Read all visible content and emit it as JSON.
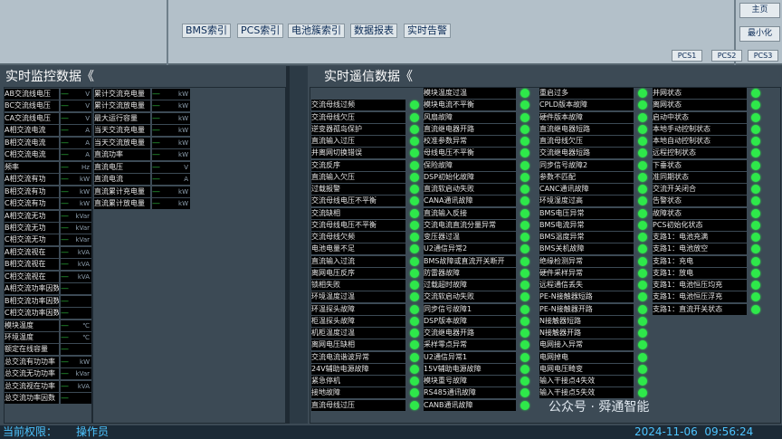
{
  "nav": [
    "BMS索引",
    "PCS索引",
    "电池簇索引",
    "数据报表",
    "实时告警"
  ],
  "side_buttons": [
    "主页",
    "最小化"
  ],
  "pcs_buttons": [
    "PCS1",
    "PCS2",
    "PCS3"
  ],
  "left_title": "实时监控数据《",
  "right_title": "实时遥信数据《",
  "left_col1": [
    {
      "label": "AB交流线电压",
      "unit": "V"
    },
    {
      "label": "BC交流线电压",
      "unit": "V"
    },
    {
      "label": "CA交流线电压",
      "unit": "V"
    },
    {
      "label": "A相交流电流",
      "unit": "A"
    },
    {
      "label": "B相交流电流",
      "unit": "A"
    },
    {
      "label": "C相交流电流",
      "unit": "A"
    },
    {
      "label": "频率",
      "unit": "Hz"
    },
    {
      "label": "A相交流有功",
      "unit": "kW"
    },
    {
      "label": "B相交流有功",
      "unit": "kW"
    },
    {
      "label": "C相交流有功",
      "unit": "kW"
    },
    {
      "label": "A相交流无功",
      "unit": "kVar"
    },
    {
      "label": "B相交流无功",
      "unit": "kVar"
    },
    {
      "label": "C相交流无功",
      "unit": "kVar"
    },
    {
      "label": "A相交流视在",
      "unit": "kVA"
    },
    {
      "label": "B相交流视在",
      "unit": "kVA"
    },
    {
      "label": "C相交流视在",
      "unit": "kVA"
    },
    {
      "label": "A相交流功率因数",
      "unit": ""
    },
    {
      "label": "B相交流功率因数",
      "unit": ""
    },
    {
      "label": "C相交流功率因数",
      "unit": ""
    },
    {
      "label": "模块温度",
      "unit": "℃"
    },
    {
      "label": "环境温度",
      "unit": "℃"
    },
    {
      "label": "额定在线容量",
      "unit": ""
    },
    {
      "label": "总交流有功功率",
      "unit": "kW"
    },
    {
      "label": "总交流无功功率",
      "unit": "kVar"
    },
    {
      "label": "总交流视在功率",
      "unit": "kVA"
    },
    {
      "label": "总交流功率因数",
      "unit": ""
    }
  ],
  "left_col2": [
    {
      "label": "累计交流充电量",
      "unit": "kW"
    },
    {
      "label": "累计交流放电量",
      "unit": "kW"
    },
    {
      "label": "最大运行容量",
      "unit": "kW"
    },
    {
      "label": "当天交流充电量",
      "unit": "kW"
    },
    {
      "label": "当天交流放电量",
      "unit": "kW"
    },
    {
      "label": "直流功率",
      "unit": "kW"
    },
    {
      "label": "直流电压",
      "unit": "V"
    },
    {
      "label": "直流电流",
      "unit": "A"
    },
    {
      "label": "直流累计充电量",
      "unit": "kW"
    },
    {
      "label": "直流累计放电量",
      "unit": "kW"
    }
  ],
  "signals_col1": [
    "",
    "交流母线过频",
    "交流母线欠压",
    "逆变器孤岛保护",
    "直流输入过压",
    "并离网切换错误",
    "交流反序",
    "直流输入欠压",
    "过载报警",
    "交流母线电压不平衡",
    "交流缺相",
    "交流母线电压不平衡",
    "交流母线欠频",
    "电池电量不足",
    "直流输入过流",
    "离网电压反序",
    "锁相失败",
    "环境温度过温",
    "环温探头故障",
    "柜温探头故障",
    "机柜温度过温",
    "离网电压缺相",
    "交流电流谐波异常",
    "24V辅助电源故障",
    "紧急停机",
    "接地故障",
    "直流母线过压"
  ],
  "signals_col2": [
    "模块温度过温",
    "模块电流不平衡",
    "风扇故障",
    "直流继电器开路",
    "校准参数异常",
    "母线电压不平衡",
    "保险故障",
    "DSP初始化故障",
    "直流软启动失败",
    "CANA通讯故障",
    "直流输入反接",
    "交流电流直流分量异常",
    "变压器过温",
    "U2通信异常2",
    "BMS故障或直流开关断开",
    "防雷器故障",
    "过载超时故障",
    "交流软启动失败",
    "同步信号故障1",
    "DSP版本故障",
    "交流继电器开路",
    "采样零点异常",
    "U2通信异常1",
    "15V辅助电源故障",
    "模块重号故障",
    "RS485通讯故障",
    "CANB通讯故障"
  ],
  "signals_col3": [
    "重启过多",
    "CPLD版本故障",
    "硬件版本故障",
    "直流继电器短路",
    "直流母线欠压",
    "交流继电器短路",
    "同步信号故障2",
    "参数不匹配",
    "CANC通讯故障",
    "环境湿度过高",
    "BMS电压异常",
    "BMS电流异常",
    "BMS温度异常",
    "BMS关机故障",
    "绝缘检测异常",
    "硬件采样异常",
    "远程通信丢失",
    "PE-N接触器短路",
    "PE-N接触器开路",
    "N接触器短路",
    "N接触器开路",
    "电网接入异常",
    "电网掉电",
    "电网电压畸变",
    "输入干接点4失效",
    "输入干接点5失效",
    ""
  ],
  "signals_col4": [
    "并网状态",
    "离网状态",
    "启动中状态",
    "本地手动控制状态",
    "本地自动控制状态",
    "远程控制状态",
    "下垂状态",
    "准同期状态",
    "交流开关闭合",
    "告警状态",
    "故障状态",
    "PCS初始化状态",
    "支路1：电池充满",
    "支路1：电池放空",
    "支路1：充电",
    "支路1：放电",
    "支路1：电池恒压均充",
    "支路1：电池恒压浮充",
    "支路1：直流开关状态",
    "",
    "",
    "",
    "",
    "",
    "",
    "",
    ""
  ],
  "status": {
    "permission_label": "当前权限：",
    "permission_value": "操作员",
    "watermark": "公众号 · 舜通智能",
    "datetime": "2024-11-06  09:56:24"
  }
}
